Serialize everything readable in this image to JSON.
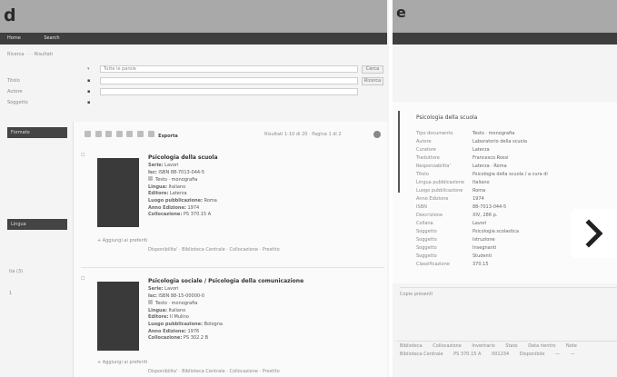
{
  "panel_left": {
    "label": "d",
    "nav": {
      "items": [
        "Home",
        "Search"
      ]
    },
    "breadcrumb": [
      "Ricerca",
      "Risultati"
    ],
    "search": {
      "rows": [
        {
          "field": "",
          "value": "",
          "placeholder": "Tutte le parole",
          "button": "Cerca"
        },
        {
          "field": "Titolo",
          "value": "",
          "placeholder": "",
          "button": "Ricerca"
        },
        {
          "field": "Autore",
          "value": "",
          "placeholder": "",
          "button": ""
        },
        {
          "field": "Soggetto",
          "value": "",
          "placeholder": "",
          "button": ""
        }
      ]
    },
    "toolbar": {
      "actions_label": "Esporta",
      "results_text": "Risultati 1-10 di 20 · Pagina 1 di 2"
    },
    "sidebar": {
      "facet1_title": "Formato",
      "facet2_title": "Lingua",
      "year_label": "ita (3)",
      "small_label": "1"
    },
    "results": [
      {
        "title": "Psicologia della scuola",
        "lines": [
          {
            "k": "Serie:",
            "v": "Lavori"
          },
          {
            "k": "Isc:",
            "v": "ISBN 88-7013-044-5"
          },
          {
            "k": "",
            "v": "Testo · monografia"
          },
          {
            "k": "Lingua:",
            "v": "Italiano"
          },
          {
            "k": "Editore:",
            "v": "Laterza"
          },
          {
            "k": "Luogo pubblicazione:",
            "v": "Roma"
          },
          {
            "k": "Anno Edizione:",
            "v": "1974"
          },
          {
            "k": "Collocazione:",
            "v": "PS 370.15 A"
          }
        ],
        "action": "+ Aggiungi ai preferiti",
        "footer": "Disponibilita'  ·  Biblioteca Centrale  ·  Collocazione · Prestito"
      },
      {
        "title": "Psicologia sociale / Psicologia della comunicazione",
        "lines": [
          {
            "k": "Serie:",
            "v": "Lavori"
          },
          {
            "k": "Isc:",
            "v": "ISBN 88-15-00000-0"
          },
          {
            "k": "",
            "v": "Testo · monografia"
          },
          {
            "k": "Lingua:",
            "v": "Italiano"
          },
          {
            "k": "Editore:",
            "v": "Il Mulino"
          },
          {
            "k": "Luogo pubblicazione:",
            "v": "Bologna"
          },
          {
            "k": "Anno Edizione:",
            "v": "1976"
          },
          {
            "k": "Collocazione:",
            "v": "PS 302.2 B"
          }
        ],
        "action": "+ Aggiungi ai preferiti",
        "footer": "Disponibilita'  ·  Biblioteca Centrale  ·  Collocazione · Prestito"
      }
    ]
  },
  "panel_right": {
    "label": "e",
    "record": {
      "title": "Psicologia della scuola",
      "rows": [
        {
          "k": "Tipo documento",
          "v": "Testo · monografia"
        },
        {
          "k": "Autore",
          "v": "Laboratorio della scuola"
        },
        {
          "k": "Curatore",
          "v": "Laterza"
        },
        {
          "k": "Traduttore",
          "v": "Francesco Rossi"
        },
        {
          "k": "Responsabilita'",
          "v": "Laterza · Roma"
        },
        {
          "k": "Titolo",
          "v": "Psicologia della scuola / a cura di"
        },
        {
          "k": "Lingua pubblicazione",
          "v": "Italiano"
        },
        {
          "k": "Luogo pubblicazione",
          "v": "Roma"
        },
        {
          "k": "Anno Edizione",
          "v": "1974"
        },
        {
          "k": "ISBN",
          "v": "88-7013-044-5"
        },
        {
          "k": "Descrizione",
          "v": "XIV, 286 p."
        },
        {
          "k": "Collana",
          "v": "Lavori"
        },
        {
          "k": "Soggetto",
          "v": "Psicologia scolastica"
        },
        {
          "k": "Soggetto",
          "v": "Istruzione"
        },
        {
          "k": "Soggetto",
          "v": "Insegnanti"
        },
        {
          "k": "Soggetto",
          "v": "Studenti"
        },
        {
          "k": "Classificazione",
          "v": "370.15"
        }
      ],
      "section2_title": "Copie presenti",
      "table_headers": [
        "Biblioteca",
        "Collocazione",
        "Inventario",
        "Stato",
        "Data rientro",
        "Note"
      ],
      "table_row": [
        "Biblioteca Centrale",
        "PS 370.15 A",
        "001234",
        "Disponibile",
        "—",
        "—"
      ]
    },
    "next_icon": "chevron-right-icon"
  }
}
